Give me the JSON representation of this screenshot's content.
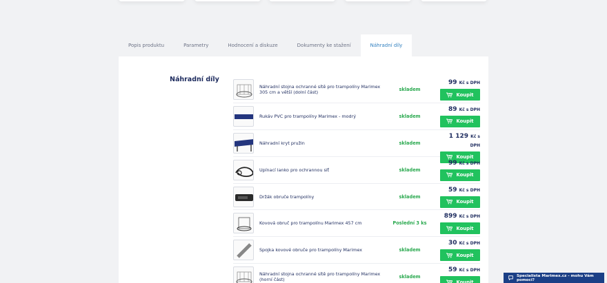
{
  "tabs": [
    {
      "label": "Popis produktu"
    },
    {
      "label": "Parametry"
    },
    {
      "label": "Hodnocení a diskuze"
    },
    {
      "label": "Dokumenty ke stažení"
    },
    {
      "label": "Náhradní díly"
    }
  ],
  "section_title": "Náhradní díly",
  "buy_label": "Koupit",
  "currency_suffix": "Kč s DPH",
  "products": [
    {
      "name": "Náhradní stojna ochranné sítě pro trampolíny Marimex 305 cm a větší (dolní část)",
      "stock": "skladem",
      "price": "99",
      "icon": "trampoline-net-icon"
    },
    {
      "name": "Rukáv PVC pro trampolíny Marimex - modrý",
      "stock": "skladem",
      "price": "89",
      "icon": "pvc-sleeve-icon"
    },
    {
      "name": "Náhradní kryt pružin",
      "stock": "skladem",
      "price": "1 129",
      "icon": "spring-cover-icon"
    },
    {
      "name": "Upínací lanko pro ochrannou síť",
      "stock": "skladem",
      "price": "99",
      "icon": "rope-icon"
    },
    {
      "name": "Držák obruče trampolíny",
      "stock": "skladem",
      "price": "59",
      "icon": "hoop-holder-icon"
    },
    {
      "name": "Kovová obruč pro trampolínu Marimex 457 cm",
      "stock": "Poslední 3 ks",
      "price": "899",
      "icon": "metal-hoop-icon"
    },
    {
      "name": "Spojka kovové obruče pro trampolíny Marimex",
      "stock": "skladem",
      "price": "30",
      "icon": "hoop-connector-icon"
    },
    {
      "name": "Náhradní stojna ochranné sítě pro trampolíny Marimex (horní část)",
      "stock": "skladem",
      "price": "59",
      "icon": "trampoline-net-icon"
    }
  ],
  "help_text": "Specialista Marimex.cz - mohu Vám pomoci?",
  "colors": {
    "accent_green": "#21c25e",
    "stock_green": "#2aa94f",
    "navy": "#1d2b5e",
    "active_tab": "#2f7fbf",
    "help_bg": "#1b3f86"
  }
}
